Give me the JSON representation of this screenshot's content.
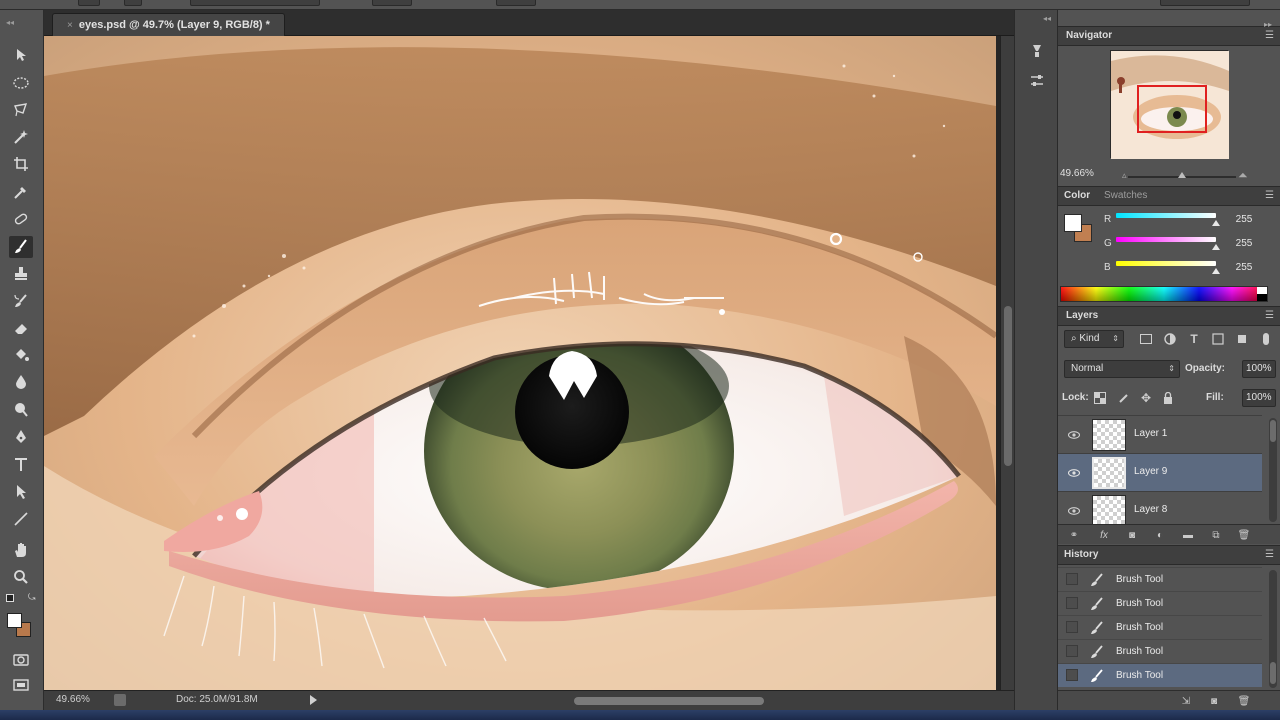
{
  "document": {
    "tab_title": "eyes.psd @ 49.7% (Layer 9, RGB/8) *",
    "close_glyph": "×",
    "zoom": "49.66%",
    "doc_info": "Doc: 25.0M/91.8M"
  },
  "toolbox": {
    "collapse_glyph": "◂◂",
    "tools": [
      "move-tool",
      "marquee-tool",
      "lasso-tool",
      "quick-selection-tool",
      "crop-tool",
      "eyedropper-tool",
      "spot-healing-tool",
      "brush-tool",
      "clone-stamp-tool",
      "history-brush-tool",
      "eraser-tool",
      "paint-bucket-tool",
      "blur-tool",
      "dodge-tool",
      "pen-tool",
      "type-tool",
      "path-selection-tool",
      "line-tool",
      "hand-tool",
      "zoom-tool"
    ],
    "active_tool": "brush-tool",
    "foreground_color": "#ffffff",
    "background_color": "#b8794c"
  },
  "navigator": {
    "title": "Navigator",
    "zoom": "49.66%"
  },
  "color_panel": {
    "tab_color": "Color",
    "tab_swatches": "Swatches",
    "channels": [
      {
        "label": "R",
        "value": "255",
        "gradient": "linear-gradient(to right,#00ffff,#ffffff)"
      },
      {
        "label": "G",
        "value": "255",
        "gradient": "linear-gradient(to right,#ff00ff,#ffffff)"
      },
      {
        "label": "B",
        "value": "255",
        "gradient": "linear-gradient(to right,#ffff00,#ffffff)"
      }
    ],
    "foreground_color": "#ffffff",
    "background_color": "#c07f51"
  },
  "layers_panel": {
    "title": "Layers",
    "filter_kind": "Kind",
    "blend_mode": "Normal",
    "opacity_label": "Opacity:",
    "opacity_value": "100%",
    "lock_label": "Lock:",
    "fill_label": "Fill:",
    "fill_value": "100%",
    "layers": [
      {
        "name": "Layer 1",
        "selected": false
      },
      {
        "name": "Layer 9",
        "selected": true
      },
      {
        "name": "Layer 8",
        "selected": false
      }
    ]
  },
  "history_panel": {
    "title": "History",
    "states": [
      {
        "name": "Brush Tool",
        "selected": false
      },
      {
        "name": "Brush Tool",
        "selected": false
      },
      {
        "name": "Brush Tool",
        "selected": false
      },
      {
        "name": "Brush Tool",
        "selected": false
      },
      {
        "name": "Brush Tool",
        "selected": true
      }
    ]
  },
  "colors": {
    "selection": "#5c6a80",
    "panel_bg": "#535353"
  }
}
